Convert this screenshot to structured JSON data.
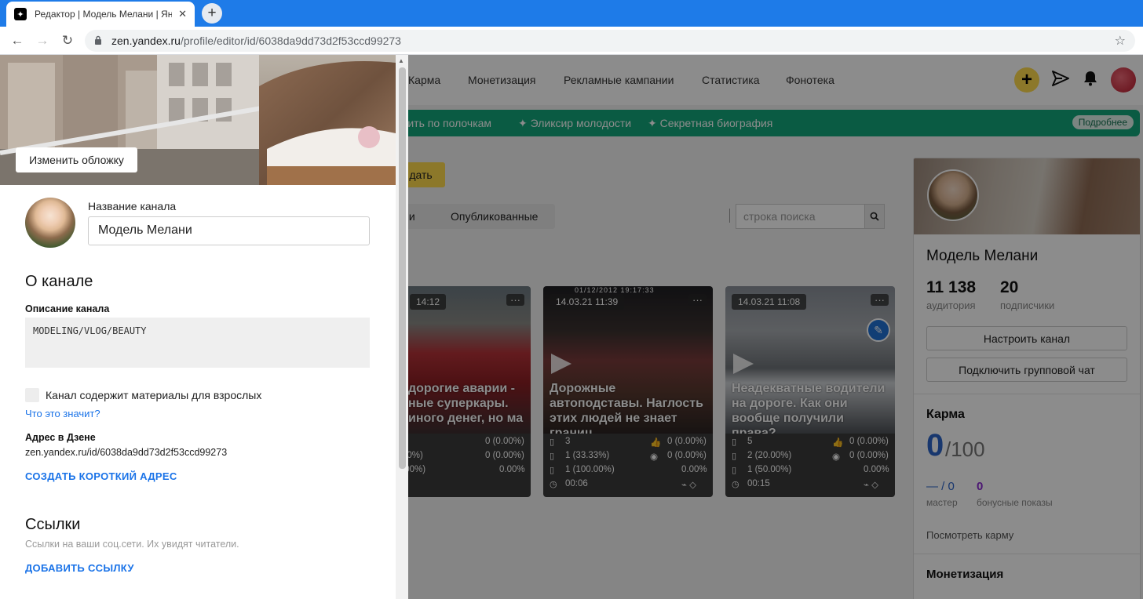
{
  "browser": {
    "tab_title": "Редактор | Модель Мелани | Ян",
    "tab_favicon": "yandex-zen-icon",
    "url_host": "zen.yandex.ru",
    "url_path": "/profile/editor/id/6038da9dd73d2f53ccd99273",
    "icons": {
      "back": "←",
      "forward": "→",
      "reload": "↻",
      "lock": "🔒",
      "star": "☆",
      "close": "✕",
      "new_tab": "+"
    }
  },
  "topnav": {
    "items": [
      "Карма",
      "Монетизация",
      "Рекламные кампании",
      "Статистика",
      "Фонотека"
    ],
    "plus": "+",
    "send": "➤",
    "bell": "🔔"
  },
  "banner": {
    "items": [
      "жить по полочкам",
      "✦ Эликсир молодости",
      "✦ Секретная биография"
    ],
    "more": "Подробнее",
    "color": "#13a77a"
  },
  "create_button": "дать",
  "filter_tabs": [
    "ции",
    "Опубликованные"
  ],
  "search": {
    "placeholder": "строка поиска",
    "icon": "🔍"
  },
  "cards": [
    {
      "date": "14:12",
      "title": "дорогие аварии - ные суперкары. иного денег, но ма",
      "stats_left": [
        "",
        "00%)",
        ".00%)",
        ""
      ],
      "stats_right": [
        "",
        "",
        "0.00%",
        ""
      ]
    },
    {
      "date": "14.03.21 11:39",
      "timestamp_overlay": "01/12/2012 19:17:33",
      "title": "Дорожные автоподставы. Наглость этих людей не знает границ",
      "stats_left": [
        "3",
        "1 (33.33%)",
        "1 (100.00%)",
        "00:06"
      ],
      "stats_right": [
        "0 (0.00%)",
        "0 (0.00%)",
        "0.00%",
        ""
      ]
    },
    {
      "date": "14.03.21 11:08",
      "title": "Неадекватные водители на дороге. Как они вообще получили права?",
      "stats_left": [
        "5",
        "2 (20.00%)",
        "1 (50.00%)",
        "00:15"
      ],
      "stats_right": [
        "0 (0.00%)",
        "0 (0.00%)",
        "0.00%",
        ""
      ]
    }
  ],
  "channel_card": {
    "name": "Модель Мелани",
    "audience_value": "11 138",
    "audience_label": "аудитория",
    "subs_value": "20",
    "subs_label": "подписчики",
    "btn_settings": "Настроить канал",
    "btn_chat": "Подключить групповой чат",
    "karma_title": "Карма",
    "karma_value": "0",
    "karma_max": "/100",
    "master_value": "— / 0",
    "master_label": "мастер",
    "bonus_value": "0",
    "bonus_label": "бонусные показы",
    "karma_link": "Посмотреть карму",
    "monetization_title": "Монетизация"
  },
  "editor": {
    "change_cover": "Изменить обложку",
    "name_label": "Название канала",
    "name_value": "Модель Мелани",
    "about_title": "О канале",
    "desc_label": "Описание канала",
    "desc_value": "MODELING/VLOG/BEAUTY",
    "adult_checkbox": "Канал содержит материалы для взрослых",
    "what_means": "Что это значит?",
    "address_label": "Адрес в Дзене",
    "address_value": "zen.yandex.ru/id/6038da9dd73d2f53ccd99273",
    "create_short": "СОЗДАТЬ КОРОТКИЙ АДРЕС",
    "links_title": "Ссылки",
    "links_hint": "Ссылки на ваши соц.сети. Их увидят читатели.",
    "add_link": "ДОБАВИТЬ ССЫЛКУ"
  }
}
